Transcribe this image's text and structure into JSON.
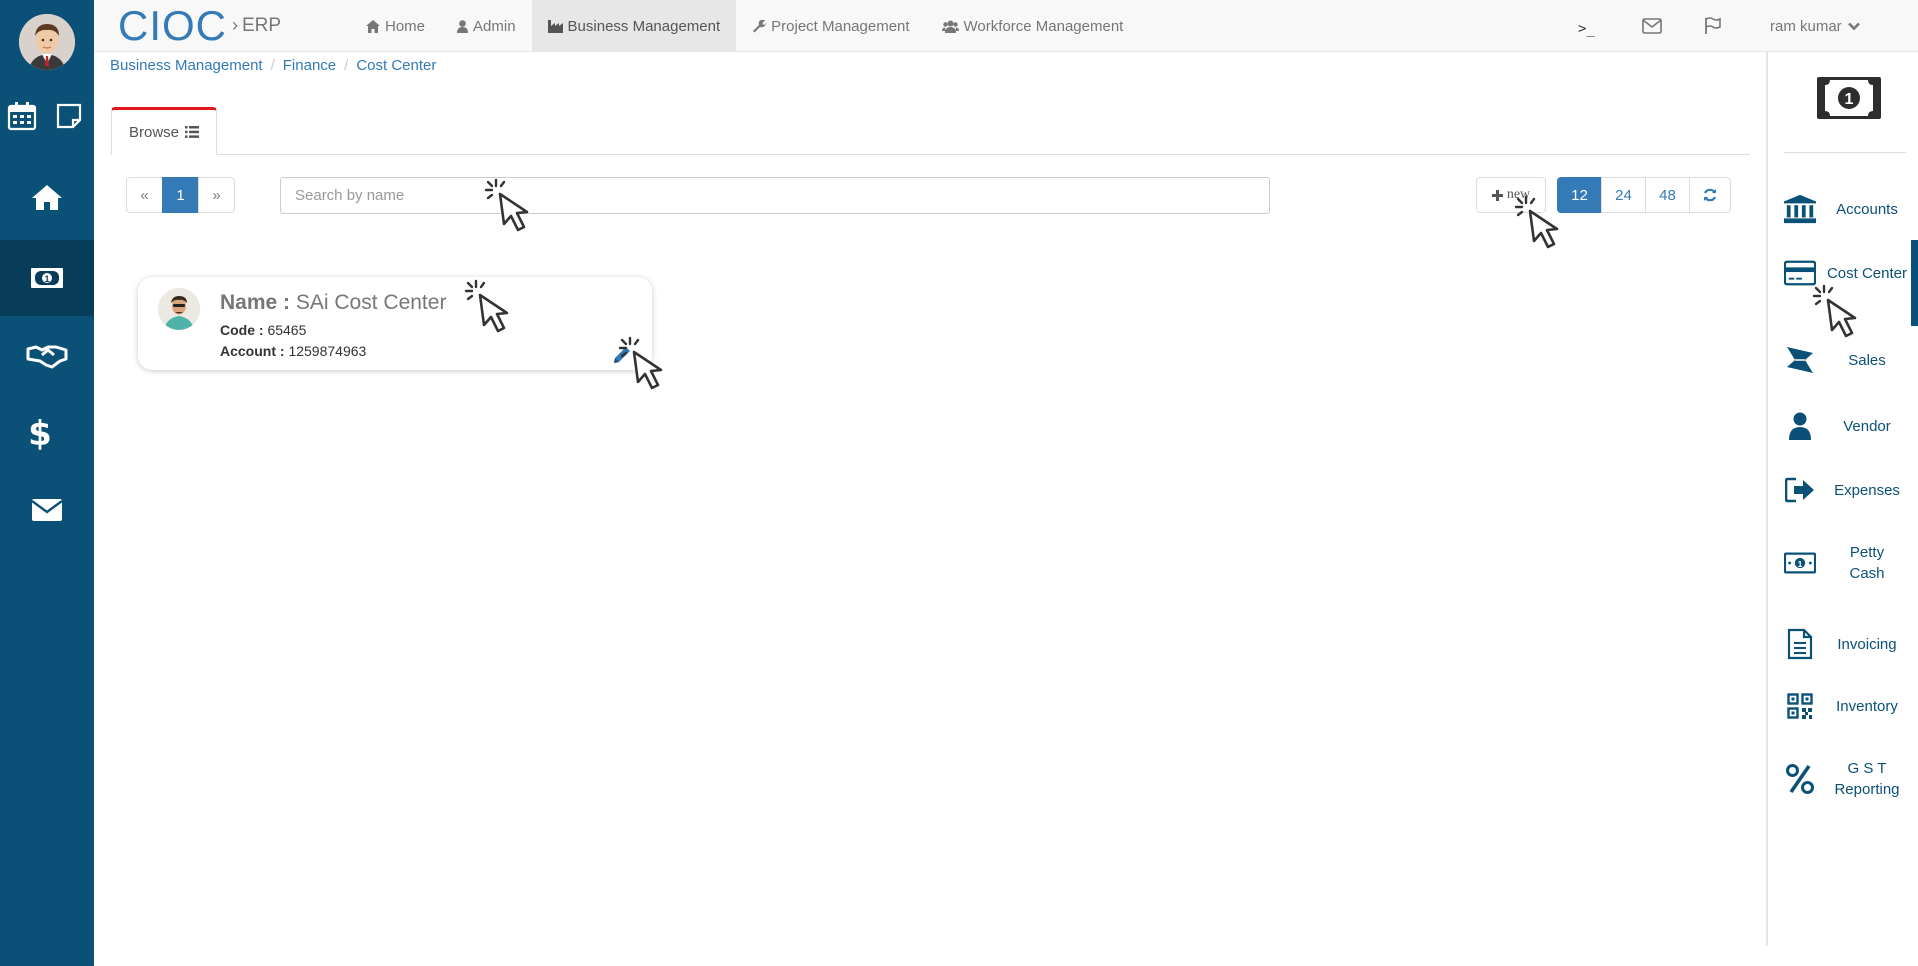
{
  "brand": {
    "name": "CIOC",
    "sub": "ERP"
  },
  "topnav": [
    {
      "label": "Home",
      "icon": "home-icon"
    },
    {
      "label": "Admin",
      "icon": "user-icon"
    },
    {
      "label": "Business Management",
      "icon": "industry-icon"
    },
    {
      "label": "Project Management",
      "icon": "wrench-icon"
    },
    {
      "label": "Workforce Management",
      "icon": "users-icon"
    }
  ],
  "topright": {
    "terminal": ">_",
    "user": "ram kumar"
  },
  "breadcrumb": [
    "Business Management",
    "Finance",
    "Cost Center"
  ],
  "tab": {
    "label": "Browse"
  },
  "pager": {
    "prev": "«",
    "page": "1",
    "next": "»"
  },
  "search": {
    "placeholder": "Search by name",
    "value": ""
  },
  "new_button": {
    "label": "new"
  },
  "page_sizes": [
    "12",
    "24",
    "48"
  ],
  "card": {
    "name_label": "Name :",
    "name": "SAi Cost Center",
    "code_label": "Code :",
    "code": "65465",
    "account_label": "Account :",
    "account": "1259874963"
  },
  "right_sidebar": [
    {
      "label": "Accounts",
      "icon": "bank-icon"
    },
    {
      "label": "Cost Center",
      "icon": "credit-card-icon"
    },
    {
      "label": "Sales",
      "icon": "sales-icon"
    },
    {
      "label": "Vendor",
      "icon": "user-icon"
    },
    {
      "label": "Expenses",
      "icon": "sign-out-icon"
    },
    {
      "label": "Petty Cash",
      "icon": "money-icon"
    },
    {
      "label": "Invoicing",
      "icon": "document-icon"
    },
    {
      "label": "Inventory",
      "icon": "qrcode-icon"
    },
    {
      "label": "G S T Reporting",
      "icon": "percent-icon"
    }
  ],
  "left_sidebar": [
    "calendar-icon",
    "sticky-note-icon",
    "home-icon",
    "money-icon",
    "handshake-icon",
    "dollar-icon",
    "envelope-icon"
  ],
  "colors": {
    "sidebar": "#0b5177",
    "accent": "#337ab7",
    "tab_active_border": "#e4161b"
  }
}
